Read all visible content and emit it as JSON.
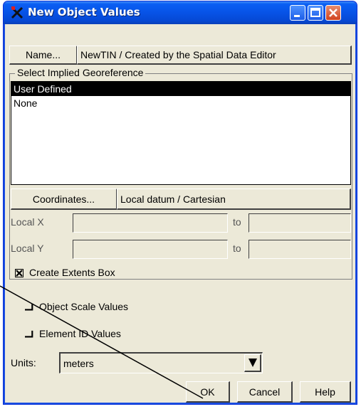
{
  "window": {
    "title": "New Object Values",
    "controls": [
      "minimize-icon",
      "maximize-icon",
      "close-icon"
    ]
  },
  "name_row": {
    "button_label": "Name...",
    "value": "NewTIN / Created by the Spatial Data Editor"
  },
  "georeference": {
    "group_title": "Select Implied Georeference",
    "items": [
      {
        "label": "User Defined",
        "selected": true
      },
      {
        "label": "None",
        "selected": false
      }
    ],
    "coordinates_button": "Coordinates...",
    "coordinates_value": "Local datum / Cartesian",
    "local_x_label": "Local X",
    "local_y_label": "Local Y",
    "to_label": "to",
    "local_x_from": "",
    "local_x_to": "",
    "local_y_from": "",
    "local_y_to": "",
    "extents_label": "Create Extents Box",
    "extents_checked": true
  },
  "options": {
    "scale_label": "Object Scale Values",
    "scale_checked": false,
    "element_id_label": "Element ID Values",
    "element_id_checked": false
  },
  "units": {
    "label": "Units:",
    "value": "meters"
  },
  "buttons": {
    "ok": "OK",
    "cancel": "Cancel",
    "help": "Help"
  },
  "colors": {
    "title_bar": "#0753e6",
    "dialog_bg": "#ece9d8",
    "selection_bg": "#000000",
    "close_button": "#d1431f"
  }
}
